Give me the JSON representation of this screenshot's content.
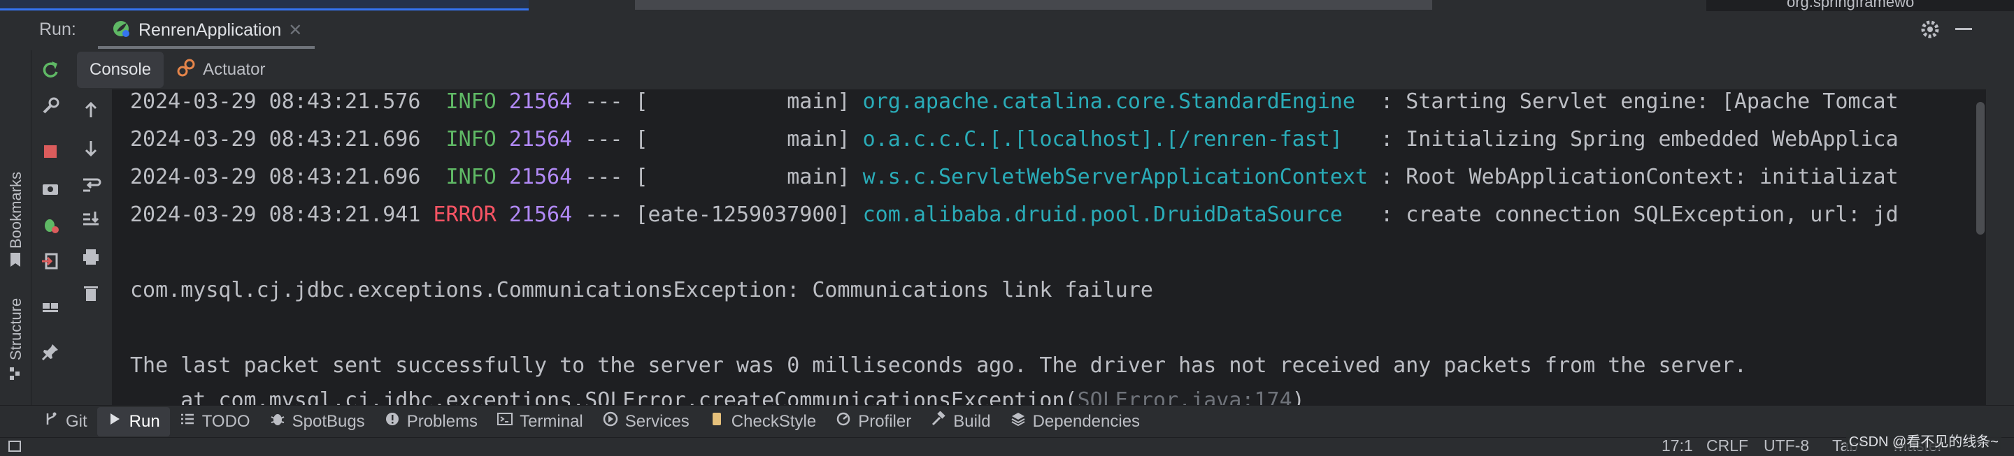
{
  "top_strip": {
    "breadcrumb": "org.springframewo"
  },
  "left_gutter": {
    "bookmarks_label": "Bookmarks",
    "structure_label": "Structure"
  },
  "run_panel": {
    "run_label": "Run:",
    "tab_name": "RenrenApplication",
    "sub_tabs": [
      {
        "label": "Console",
        "active": true
      },
      {
        "label": "Actuator",
        "active": false
      }
    ]
  },
  "console": {
    "log_lines": [
      {
        "ts": "2024-03-29 08:43:21.576",
        "level": "INFO",
        "pid": "21564",
        "sep": "---",
        "thread": "[           main]",
        "logger": "org.apache.catalina.core.StandardEngine ",
        "msg": " : Starting Servlet engine: [Apache Tomcat"
      },
      {
        "ts": "2024-03-29 08:43:21.696",
        "level": "INFO",
        "pid": "21564",
        "sep": "---",
        "thread": "[           main]",
        "logger": "o.a.c.c.C.[.[localhost].[/renren-fast]  ",
        "msg": " : Initializing Spring embedded WebApplica"
      },
      {
        "ts": "2024-03-29 08:43:21.696",
        "level": "INFO",
        "pid": "21564",
        "sep": "---",
        "thread": "[           main]",
        "logger": "w.s.c.ServletWebServerApplicationContext",
        "msg": " : Root WebApplicationContext: initializat"
      },
      {
        "ts": "2024-03-29 08:43:21.941",
        "level": "ERROR",
        "pid": "21564",
        "sep": "---",
        "thread": "[eate-1259037900]",
        "logger": "com.alibaba.druid.pool.DruidDataSource  ",
        "msg": " : create connection SQLException, url: jd"
      }
    ],
    "exception_line": "com.mysql.cj.jdbc.exceptions.CommunicationsException: Communications link failure",
    "packet_line": "The last packet sent successfully to the server was 0 milliseconds ago. The driver has not received any packets from the server.",
    "stack_line_prefix": "    at com.mysql.cj.jdbc.exceptions.SQLError.createCommunicationsException(",
    "stack_line_source": "SQLError.java:174",
    "stack_line_suffix": ")"
  },
  "bottom_tabs": [
    {
      "label": "Git",
      "icon": "git-icon"
    },
    {
      "label": "Run",
      "icon": "play-icon",
      "active": true
    },
    {
      "label": "TODO",
      "icon": "list-icon"
    },
    {
      "label": "SpotBugs",
      "icon": "bug-icon"
    },
    {
      "label": "Problems",
      "icon": "info-icon"
    },
    {
      "label": "Terminal",
      "icon": "terminal-icon"
    },
    {
      "label": "Services",
      "icon": "services-icon"
    },
    {
      "label": "CheckStyle",
      "icon": "checkstyle-icon"
    },
    {
      "label": "Profiler",
      "icon": "profiler-icon"
    },
    {
      "label": "Build",
      "icon": "hammer-icon"
    },
    {
      "label": "Dependencies",
      "icon": "layers-icon"
    }
  ],
  "status_bar": {
    "position": "17:1",
    "line_sep": "CRLF",
    "encoding": "UTF-8",
    "indent": "Tab*",
    "branch": "master"
  },
  "watermark": "CSDN @看不见的线条~",
  "colors": {
    "info": "#5fb865",
    "error": "#f75464",
    "pid": "#b189f5",
    "logger": "#2aacb8",
    "console_bg": "#1e1f22",
    "panel_bg": "#2b2d30"
  }
}
